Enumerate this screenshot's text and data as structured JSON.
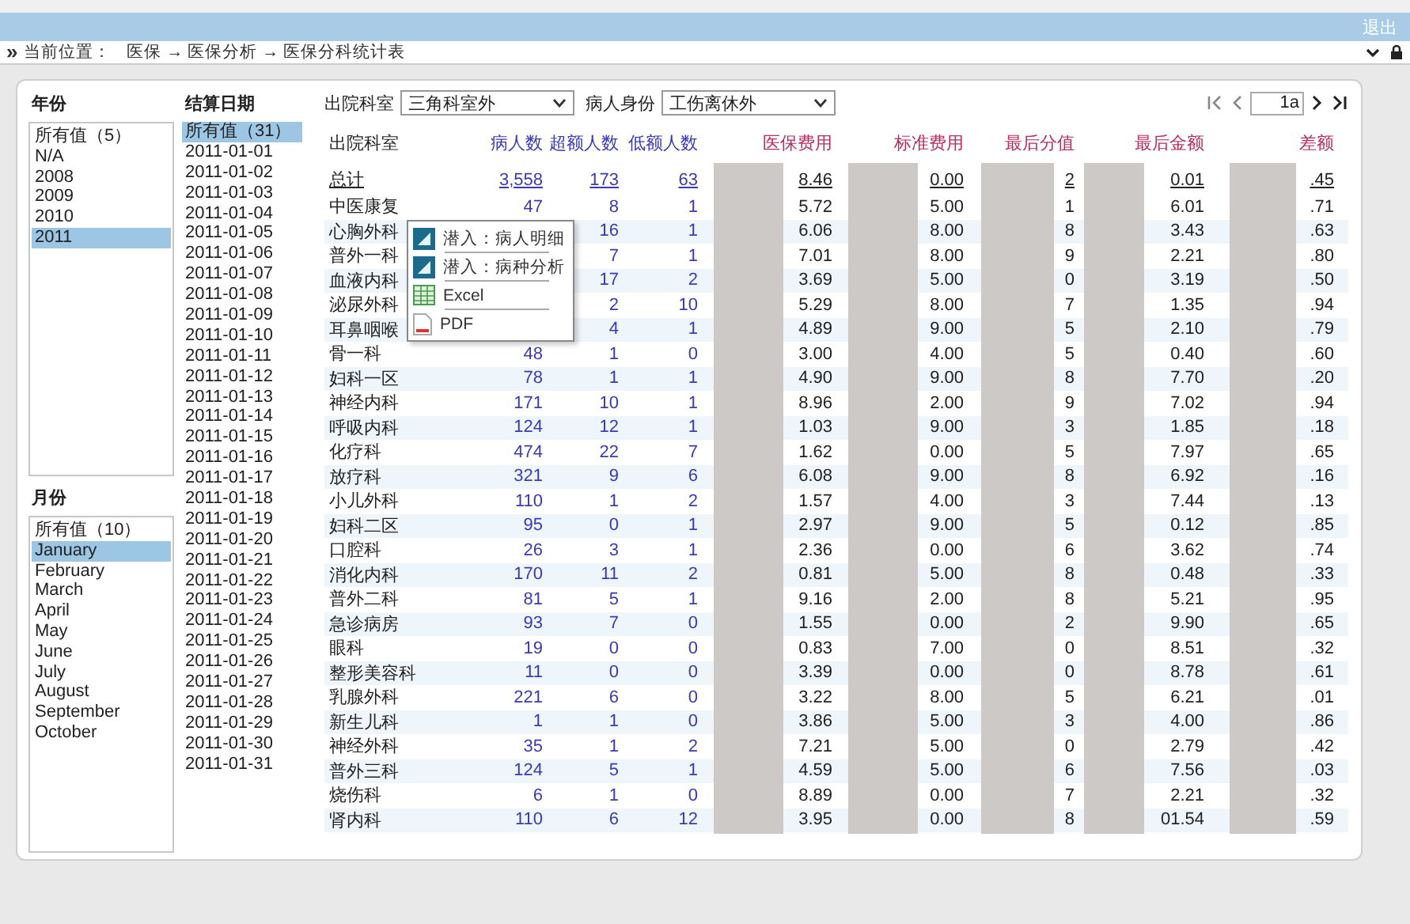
{
  "header": {
    "logout": "退出"
  },
  "breadcrumb": {
    "expand": "»",
    "label": "当前位置：",
    "path": "医保 → 医保分析 → 医保分科统计表"
  },
  "year_filter": {
    "title": "年份",
    "items": [
      {
        "label": "所有值（5）",
        "selected": false
      },
      {
        "label": "N/A",
        "selected": false
      },
      {
        "label": "2008",
        "selected": false
      },
      {
        "label": "2009",
        "selected": false
      },
      {
        "label": "2010",
        "selected": false
      },
      {
        "label": "2011",
        "selected": true
      }
    ]
  },
  "month_filter": {
    "title": "月份",
    "items": [
      {
        "label": "所有值（10）",
        "selected": false
      },
      {
        "label": "January",
        "selected": true
      },
      {
        "label": "February",
        "selected": false
      },
      {
        "label": "March",
        "selected": false
      },
      {
        "label": "April",
        "selected": false
      },
      {
        "label": "May",
        "selected": false
      },
      {
        "label": "June",
        "selected": false
      },
      {
        "label": "July",
        "selected": false
      },
      {
        "label": "August",
        "selected": false
      },
      {
        "label": "September",
        "selected": false
      },
      {
        "label": "October",
        "selected": false
      }
    ]
  },
  "date_filter": {
    "title": "结算日期",
    "items": [
      {
        "label": "所有值（31）",
        "selected": true
      },
      {
        "label": "2011-01-01",
        "selected": false
      },
      {
        "label": "2011-01-02",
        "selected": false
      },
      {
        "label": "2011-01-03",
        "selected": false
      },
      {
        "label": "2011-01-04",
        "selected": false
      },
      {
        "label": "2011-01-05",
        "selected": false
      },
      {
        "label": "2011-01-06",
        "selected": false
      },
      {
        "label": "2011-01-07",
        "selected": false
      },
      {
        "label": "2011-01-08",
        "selected": false
      },
      {
        "label": "2011-01-09",
        "selected": false
      },
      {
        "label": "2011-01-10",
        "selected": false
      },
      {
        "label": "2011-01-11",
        "selected": false
      },
      {
        "label": "2011-01-12",
        "selected": false
      },
      {
        "label": "2011-01-13",
        "selected": false
      },
      {
        "label": "2011-01-14",
        "selected": false
      },
      {
        "label": "2011-01-15",
        "selected": false
      },
      {
        "label": "2011-01-16",
        "selected": false
      },
      {
        "label": "2011-01-17",
        "selected": false
      },
      {
        "label": "2011-01-18",
        "selected": false
      },
      {
        "label": "2011-01-19",
        "selected": false
      },
      {
        "label": "2011-01-20",
        "selected": false
      },
      {
        "label": "2011-01-21",
        "selected": false
      },
      {
        "label": "2011-01-22",
        "selected": false
      },
      {
        "label": "2011-01-23",
        "selected": false
      },
      {
        "label": "2011-01-24",
        "selected": false
      },
      {
        "label": "2011-01-25",
        "selected": false
      },
      {
        "label": "2011-01-26",
        "selected": false
      },
      {
        "label": "2011-01-27",
        "selected": false
      },
      {
        "label": "2011-01-28",
        "selected": false
      },
      {
        "label": "2011-01-29",
        "selected": false
      },
      {
        "label": "2011-01-30",
        "selected": false
      },
      {
        "label": "2011-01-31",
        "selected": false
      }
    ]
  },
  "toolbar": {
    "filters": [
      {
        "label": "出院科室",
        "value": "三角科室外"
      },
      {
        "label": "病人身份",
        "value": "工伤离休外"
      }
    ],
    "pager": {
      "page": "1a"
    }
  },
  "table": {
    "columns": [
      {
        "label": "出院科室",
        "kind": "name"
      },
      {
        "label": "病人数",
        "kind": "count"
      },
      {
        "label": "超额人数",
        "kind": "count"
      },
      {
        "label": "低额人数",
        "kind": "count"
      },
      {
        "label": "医保费用",
        "kind": "money"
      },
      {
        "label": "标准费用",
        "kind": "money"
      },
      {
        "label": "最后分值",
        "kind": "money"
      },
      {
        "label": "最后金额",
        "kind": "money"
      },
      {
        "label": "差额",
        "kind": "money"
      }
    ],
    "total": [
      "总计",
      "3,558",
      "173",
      "63",
      "8.46",
      "0.00",
      "2",
      "0.01",
      ".45"
    ],
    "rows": [
      [
        "中医康复",
        "47",
        "8",
        "1",
        "5.72",
        "5.00",
        "1",
        "6.01",
        ".71"
      ],
      [
        "心胸外科",
        "",
        "16",
        "1",
        "6.06",
        "8.00",
        "8",
        "3.43",
        ".63"
      ],
      [
        "普外一科",
        "",
        "7",
        "1",
        "7.01",
        "8.00",
        "9",
        "2.21",
        ".80"
      ],
      [
        "血液内科",
        "",
        "17",
        "2",
        "3.69",
        "5.00",
        "0",
        "3.19",
        ".50"
      ],
      [
        "泌尿外科",
        "",
        "2",
        "10",
        "5.29",
        "8.00",
        "7",
        "1.35",
        ".94"
      ],
      [
        "耳鼻咽喉",
        "",
        "4",
        "1",
        "4.89",
        "9.00",
        "5",
        "2.10",
        ".79"
      ],
      [
        "骨一科",
        "48",
        "1",
        "0",
        "3.00",
        "4.00",
        "5",
        "0.40",
        ".60"
      ],
      [
        "妇科一区",
        "78",
        "1",
        "1",
        "4.90",
        "9.00",
        "8",
        "7.70",
        ".20"
      ],
      [
        "神经内科",
        "171",
        "10",
        "1",
        "8.96",
        "2.00",
        "9",
        "7.02",
        ".94"
      ],
      [
        "呼吸内科",
        "124",
        "12",
        "1",
        "1.03",
        "9.00",
        "3",
        "1.85",
        ".18"
      ],
      [
        "化疗科",
        "474",
        "22",
        "7",
        "1.62",
        "0.00",
        "5",
        "7.97",
        ".65"
      ],
      [
        "放疗科",
        "321",
        "9",
        "6",
        "6.08",
        "9.00",
        "8",
        "6.92",
        ".16"
      ],
      [
        "小儿外科",
        "110",
        "1",
        "2",
        "1.57",
        "4.00",
        "3",
        "7.44",
        ".13"
      ],
      [
        "妇科二区",
        "95",
        "0",
        "1",
        "2.97",
        "9.00",
        "5",
        "0.12",
        ".85"
      ],
      [
        "口腔科",
        "26",
        "3",
        "1",
        "2.36",
        "0.00",
        "6",
        "3.62",
        ".74"
      ],
      [
        "消化内科",
        "170",
        "11",
        "2",
        "0.81",
        "5.00",
        "8",
        "0.48",
        ".33"
      ],
      [
        "普外二科",
        "81",
        "5",
        "1",
        "9.16",
        "2.00",
        "8",
        "5.21",
        ".95"
      ],
      [
        "急诊病房",
        "93",
        "7",
        "0",
        "1.55",
        "0.00",
        "2",
        "9.90",
        ".65"
      ],
      [
        "眼科",
        "19",
        "0",
        "0",
        "0.83",
        "7.00",
        "0",
        "8.51",
        ".32"
      ],
      [
        "整形美容科",
        "11",
        "0",
        "0",
        "3.39",
        "0.00",
        "0",
        "8.78",
        ".61"
      ],
      [
        "乳腺外科",
        "221",
        "6",
        "0",
        "3.22",
        "8.00",
        "5",
        "6.21",
        ".01"
      ],
      [
        "新生儿科",
        "1",
        "1",
        "0",
        "3.86",
        "5.00",
        "3",
        "4.00",
        ".86"
      ],
      [
        "神经外科",
        "35",
        "1",
        "2",
        "7.21",
        "5.00",
        "0",
        "2.79",
        ".42"
      ],
      [
        "普外三科",
        "124",
        "5",
        "1",
        "4.59",
        "5.00",
        "6",
        "7.56",
        ".03"
      ],
      [
        "烧伤科",
        "6",
        "1",
        "0",
        "8.89",
        "0.00",
        "7",
        "2.21",
        ".32"
      ],
      [
        "肾内科",
        "110",
        "6",
        "12",
        "3.95",
        "0.00",
        "8",
        "01.54",
        ".59"
      ]
    ]
  },
  "context_menu": {
    "items": [
      {
        "label": "潜入：病人明细",
        "kind": "drill"
      },
      {
        "label": "潜入：病种分析",
        "kind": "drill"
      },
      {
        "label": "Excel",
        "kind": "excel"
      },
      {
        "label": "PDF",
        "kind": "pdf"
      }
    ]
  }
}
